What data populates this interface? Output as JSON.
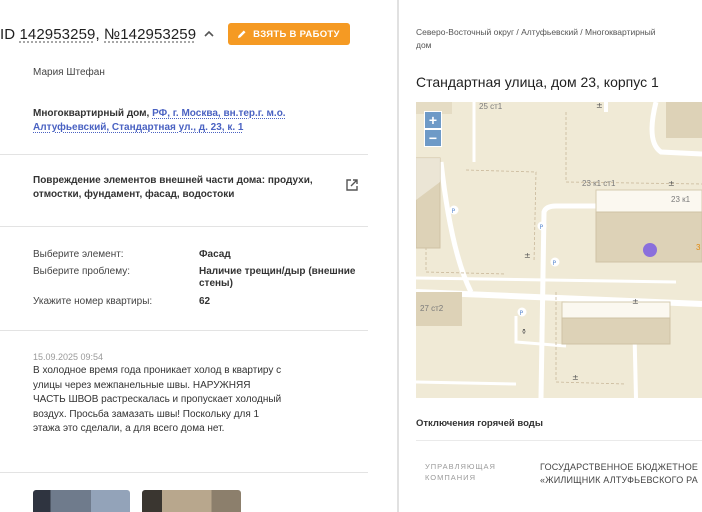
{
  "header": {
    "ids_text_prefix": "ID ",
    "id1": "142953259",
    "id_sep": ", ",
    "id2": "№142953259",
    "take_button": "ВЗЯТЬ В РАБОТУ"
  },
  "request": {
    "author": "Мария Штефан",
    "address_prefix": "Многоквартирный дом, ",
    "address_link": "РФ, г. Москва, вн.тер.г. м.о. Алтуфьевский, Стандартная ул., д. 23, к. 1",
    "category": "Повреждение элементов внешней части дома: продухи, отмостки, фундамент, фасад, водостоки",
    "fields": [
      {
        "label": "Выберите элемент:",
        "value": "Фасад"
      },
      {
        "label": "Выберите проблему:",
        "value": "Наличие трещин/дыр (внешние стены)"
      },
      {
        "label": "Укажите номер квартиры:",
        "value": "62"
      }
    ],
    "comment_date": "15.09.2025 09:54",
    "comment_text": "В холодное время года проникает холод в квартиру с улицы через межпанельные швы. НАРУЖНЯЯ ЧАСТЬ ШВОВ растрескалась и пропускает холодный воздух. Просьба замазать швы! Поскольку для 1 этажа это сделали, а для всего дома нет."
  },
  "right": {
    "breadcrumb": "Северо-Восточный округ / Алтуфьевский / Многоквартирный дом",
    "title": "Стандартная улица, дом 23, корпус 1",
    "map_labels": {
      "a": "25 ст1",
      "b": "23 к1 ст1",
      "c": "23 к1",
      "d": "27 ст2",
      "e": "3"
    },
    "zoom_in": "+",
    "zoom_out": "−",
    "section_title": "Отключения горячей воды",
    "mgmt_label": "УПРАВЛЯЮЩАЯ КОМПАНИЯ",
    "mgmt_value_line1": "ГОСУДАРСТВЕННОЕ БЮДЖЕТНОЕ",
    "mgmt_value_line2": "«ЖИЛИЩНИК АЛТУФЬЕВСКОГО РА"
  },
  "colors": {
    "accent": "#f59a23",
    "link": "#4a62c2",
    "map_bg": "#f0ead6",
    "building": "#ddd2b7",
    "marker": "#8a6fdc",
    "zoom": "#6e9ac7"
  }
}
